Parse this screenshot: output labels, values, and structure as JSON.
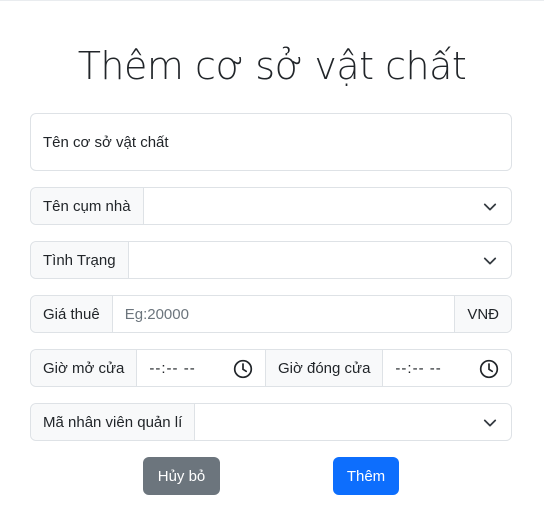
{
  "title": "Thêm cơ sở vật chất",
  "form": {
    "facility_name": {
      "placeholder": "Tên cơ sở vật chất"
    },
    "building_cluster": {
      "label": "Tên cụm nhà",
      "value": ""
    },
    "status": {
      "label": "Tình Trạng",
      "value": ""
    },
    "price": {
      "label": "Giá thuê",
      "placeholder": "Eg:20000",
      "unit": "VNĐ"
    },
    "open_time": {
      "label": "Giờ mở cửa",
      "value": "--:-- --"
    },
    "close_time": {
      "label": "Giờ đóng cửa",
      "value": "--:-- --"
    },
    "manager_id": {
      "label": "Mã nhân viên quản lí",
      "value": ""
    }
  },
  "buttons": {
    "cancel": "Hủy bỏ",
    "add": "Thêm"
  },
  "colors": {
    "primary": "#0d6efd",
    "secondary": "#6c757d",
    "border": "#dee2e6",
    "addon_bg": "#f8f9fa"
  },
  "icons": {
    "select_arrow": "chevron-down-icon",
    "time": "clock-icon"
  }
}
